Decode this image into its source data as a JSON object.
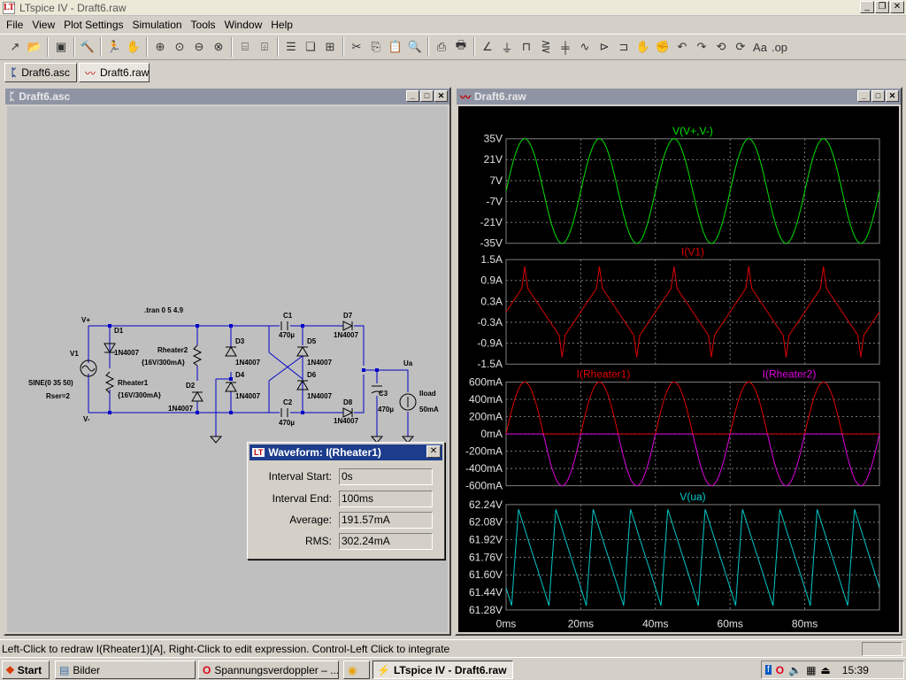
{
  "app": {
    "title": "LTspice IV - Draft6.raw",
    "logo": "LT"
  },
  "window_buttons": [
    "_",
    "❐",
    "✕"
  ],
  "menu": [
    "File",
    "View",
    "Plot Settings",
    "Simulation",
    "Tools",
    "Window",
    "Help"
  ],
  "toolbar": [
    {
      "icon": "new-schematic-icon",
      "glyph": "↗"
    },
    {
      "icon": "open-icon",
      "glyph": "📂"
    },
    {
      "sep": true
    },
    {
      "icon": "save-icon",
      "glyph": "▣"
    },
    {
      "sep": true
    },
    {
      "icon": "control-panel-icon",
      "glyph": "🔨"
    },
    {
      "sep": true
    },
    {
      "icon": "run-icon",
      "glyph": "🏃"
    },
    {
      "icon": "halt-icon",
      "glyph": "✋"
    },
    {
      "sep": true
    },
    {
      "icon": "zoom-in-icon",
      "glyph": "⊕"
    },
    {
      "icon": "zoom-pan-icon",
      "glyph": "⊙"
    },
    {
      "icon": "zoom-out-icon",
      "glyph": "⊖"
    },
    {
      "icon": "zoom-fit-icon",
      "glyph": "⊗"
    },
    {
      "sep": true
    },
    {
      "icon": "autorange-icon",
      "glyph": "⌸"
    },
    {
      "icon": "zoom-extent-icon",
      "glyph": "⌹"
    },
    {
      "sep": true
    },
    {
      "icon": "tile-horizontal-icon",
      "glyph": "☰"
    },
    {
      "icon": "cascade-icon",
      "glyph": "❏"
    },
    {
      "icon": "tile-vertical-icon",
      "glyph": "⊞"
    },
    {
      "sep": true
    },
    {
      "icon": "cut-icon",
      "glyph": "✂"
    },
    {
      "icon": "copy-icon",
      "glyph": "⎘"
    },
    {
      "icon": "paste-icon",
      "glyph": "📋"
    },
    {
      "icon": "find-icon",
      "glyph": "🔍"
    },
    {
      "sep": true
    },
    {
      "icon": "print-preview-icon",
      "glyph": "⎙"
    },
    {
      "icon": "print-icon",
      "glyph": "🖶"
    },
    {
      "sep": true
    },
    {
      "icon": "draw-wire-icon",
      "glyph": "∠"
    },
    {
      "icon": "ground-icon",
      "glyph": "⏚"
    },
    {
      "icon": "label-net-icon",
      "glyph": "⊓"
    },
    {
      "icon": "resistor-icon",
      "glyph": "⋛"
    },
    {
      "icon": "capacitor-icon",
      "glyph": "╪"
    },
    {
      "icon": "inductor-icon",
      "glyph": "∿"
    },
    {
      "icon": "diode-icon",
      "glyph": "⊳"
    },
    {
      "icon": "component-icon",
      "glyph": "⊐"
    },
    {
      "icon": "move-icon",
      "glyph": "✋"
    },
    {
      "icon": "drag-icon",
      "glyph": "✊"
    },
    {
      "icon": "undo-icon",
      "glyph": "↶"
    },
    {
      "icon": "redo-icon",
      "glyph": "↷"
    },
    {
      "icon": "rotate-icon",
      "glyph": "⟲"
    },
    {
      "icon": "mirror-icon",
      "glyph": "⟳"
    },
    {
      "icon": "text-icon",
      "glyph": "Aa"
    },
    {
      "icon": "spice-directive-icon",
      "glyph": ".op"
    }
  ],
  "tabs": [
    {
      "label": "Draft6.asc",
      "icon": "schematic-icon",
      "active": false
    },
    {
      "label": "Draft6.raw",
      "icon": "waveform-icon",
      "active": true
    }
  ],
  "schematic": {
    "title": "Draft6.asc",
    "labels": {
      "vplus": "V+",
      "vminus": "V-",
      "v1": "V1",
      "sine": "SINE(0 35 50)",
      "rser": "Rser=2",
      "d1": "D1",
      "d1m": "1N4007",
      "d2": "D2",
      "d2m": "1N4007",
      "rh1": "Rheater1",
      "rh1v": "{16V/300mA}",
      "rh2": "Rheater2",
      "rh2v": "{16V/300mA}",
      "d3": "D3",
      "d3m": "1N4007",
      "d4": "D4",
      "d4m": "1N4007",
      "c1": "C1",
      "c1v": "470µ",
      "c2": "C2",
      "c2v": "470µ",
      "d5": "D5",
      "d5m": "1N4007",
      "d6": "D6",
      "d6m": "1N4007",
      "d7": "D7",
      "d7m": "1N4007",
      "d8": "D8",
      "d8m": "1N4007",
      "tran": ".tran 0 5 4.9",
      "ua": "Ua",
      "c3": "C3",
      "c3v": "470µ",
      "iload": "Iload",
      "iloadv": "50mA"
    }
  },
  "plot": {
    "title": "Draft6.raw",
    "x_ticks": [
      "0ms",
      "20ms",
      "40ms",
      "60ms",
      "80ms"
    ],
    "panes": [
      {
        "labels": [
          "V(V+,V-)"
        ],
        "colors": [
          "#00e000"
        ],
        "y_ticks": [
          "35V",
          "21V",
          "7V",
          "-7V",
          "-21V",
          "-35V"
        ]
      },
      {
        "labels": [
          "I(V1)"
        ],
        "colors": [
          "#e00000"
        ],
        "y_ticks": [
          "1.5A",
          "0.9A",
          "0.3A",
          "-0.3A",
          "-0.9A",
          "-1.5A"
        ]
      },
      {
        "labels": [
          "I(Rheater1)",
          "I(Rheater2)"
        ],
        "colors": [
          "#e00000",
          "#e000e0"
        ],
        "y_ticks": [
          "600mA",
          "400mA",
          "200mA",
          "0mA",
          "-200mA",
          "-400mA",
          "-600mA"
        ]
      },
      {
        "labels": [
          "V(ua)"
        ],
        "colors": [
          "#00c8c8"
        ],
        "y_ticks": [
          "62.24V",
          "62.08V",
          "61.92V",
          "61.76V",
          "61.60V",
          "61.44V",
          "61.28V"
        ]
      }
    ]
  },
  "chart_data": {
    "type": "line",
    "title": "",
    "xlabel": "",
    "xlim": [
      0,
      100
    ],
    "x_unit": "ms",
    "panes": [
      {
        "series": [
          {
            "name": "V(V+,V-)",
            "waveform": "sine",
            "amplitude": 35,
            "offset": 0,
            "frequency_hz": 50
          }
        ],
        "ylim": [
          -35,
          35
        ],
        "unit": "V"
      },
      {
        "series": [
          {
            "name": "I(V1)",
            "waveform": "triangular-with-diode-peaks",
            "peak": 1.3,
            "frequency_hz": 50
          }
        ],
        "ylim": [
          -1.5,
          1.5
        ],
        "unit": "A"
      },
      {
        "series": [
          {
            "name": "I(Rheater1)",
            "waveform": "half-wave-positive",
            "peak": 0.6,
            "frequency_hz": 50
          },
          {
            "name": "I(Rheater2)",
            "waveform": "half-wave-negative",
            "peak": -0.6,
            "frequency_hz": 50
          }
        ],
        "ylim": [
          -0.6,
          0.6
        ],
        "unit": "A"
      },
      {
        "series": [
          {
            "name": "V(ua)",
            "waveform": "sawtooth-ripple",
            "max": 62.2,
            "min": 61.32,
            "frequency_hz": 100
          }
        ],
        "ylim": [
          61.28,
          62.24
        ],
        "unit": "V"
      }
    ]
  },
  "waveform_dialog": {
    "title": "Waveform: I(Rheater1)",
    "rows": [
      {
        "label": "Interval Start:",
        "value": "0s"
      },
      {
        "label": "Interval End:",
        "value": "100ms"
      },
      {
        "label": "Average:",
        "value": "191.57mA"
      },
      {
        "label": "RMS:",
        "value": "302.24mA"
      }
    ]
  },
  "status": "Left-Click to redraw I(Rheater1)[A],  Right-Click to edit expression. Control-Left Click to integrate",
  "taskbar": {
    "start": "Start",
    "items": [
      {
        "label": "Bilder",
        "icon": "folder-icon"
      },
      {
        "label": "Spannungsverdoppler – ...",
        "icon": "opera-icon"
      },
      {
        "label": "",
        "icon": "chrome-icon"
      },
      {
        "label": "LTspice IV - Draft6.raw",
        "icon": "ltspice-icon"
      }
    ],
    "clock": "15:39"
  }
}
